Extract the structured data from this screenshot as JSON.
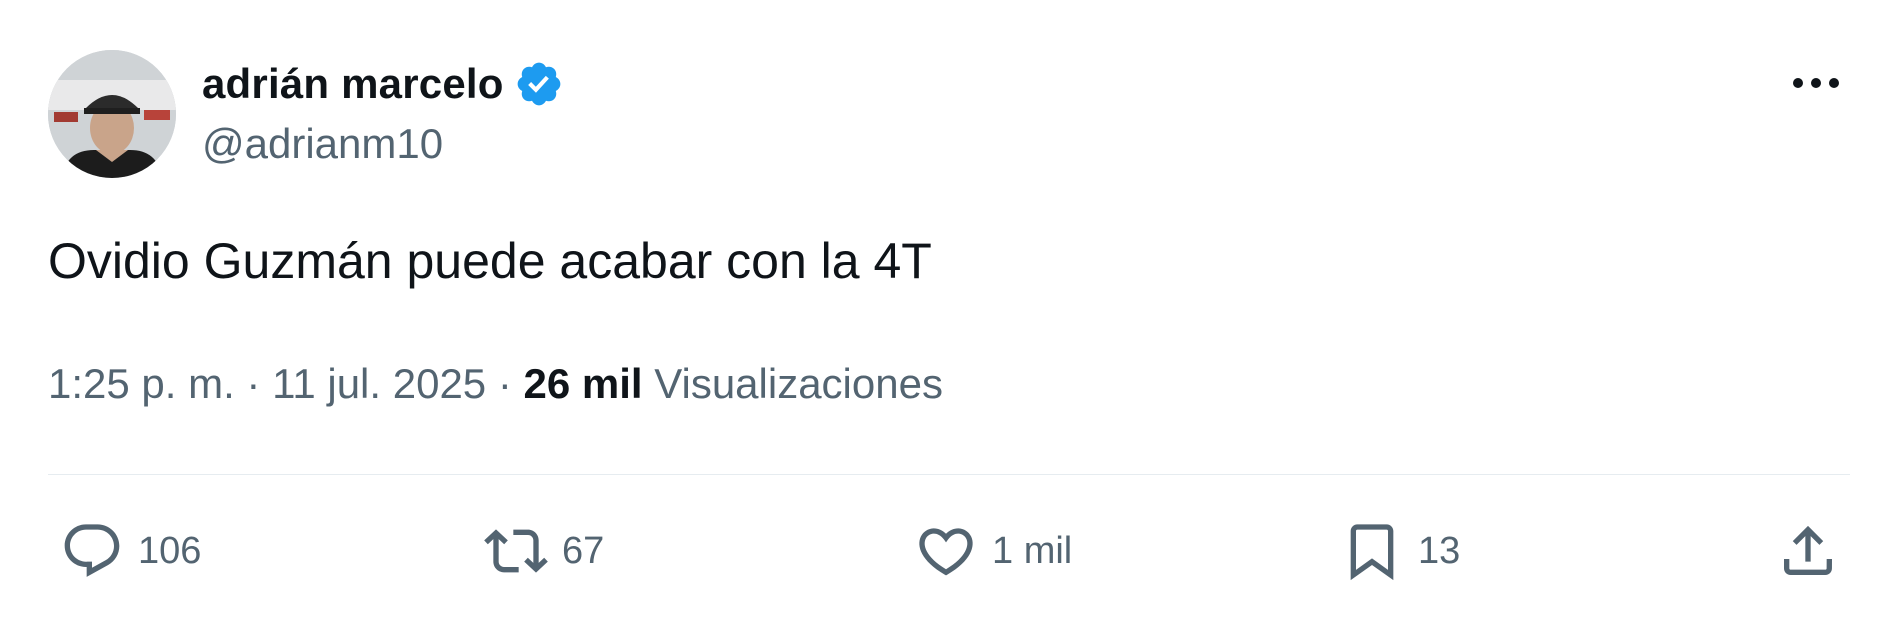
{
  "author": {
    "display_name": "adrián marcelo",
    "handle": "@adrianm10",
    "verified": true,
    "avatar": "person-avatar"
  },
  "tweet": {
    "text": "Ovidio Guzmán puede acabar con la 4T"
  },
  "meta": {
    "time": "1:25 p. m.",
    "separator": " · ",
    "date": "11 jul. 2025",
    "views_count": "26 mil",
    "views_label": "Visualizaciones"
  },
  "actions": {
    "reply": {
      "icon": "reply-icon",
      "count": "106"
    },
    "retweet": {
      "icon": "retweet-icon",
      "count": "67"
    },
    "like": {
      "icon": "heart-icon",
      "count": "1 mil"
    },
    "bookmark": {
      "icon": "bookmark-icon",
      "count": "13"
    },
    "share": {
      "icon": "share-icon"
    }
  },
  "colors": {
    "verified_blue": "#1d9bf0",
    "text_primary": "#0f1419",
    "text_secondary": "#536471",
    "divider": "#e6ecf0"
  }
}
